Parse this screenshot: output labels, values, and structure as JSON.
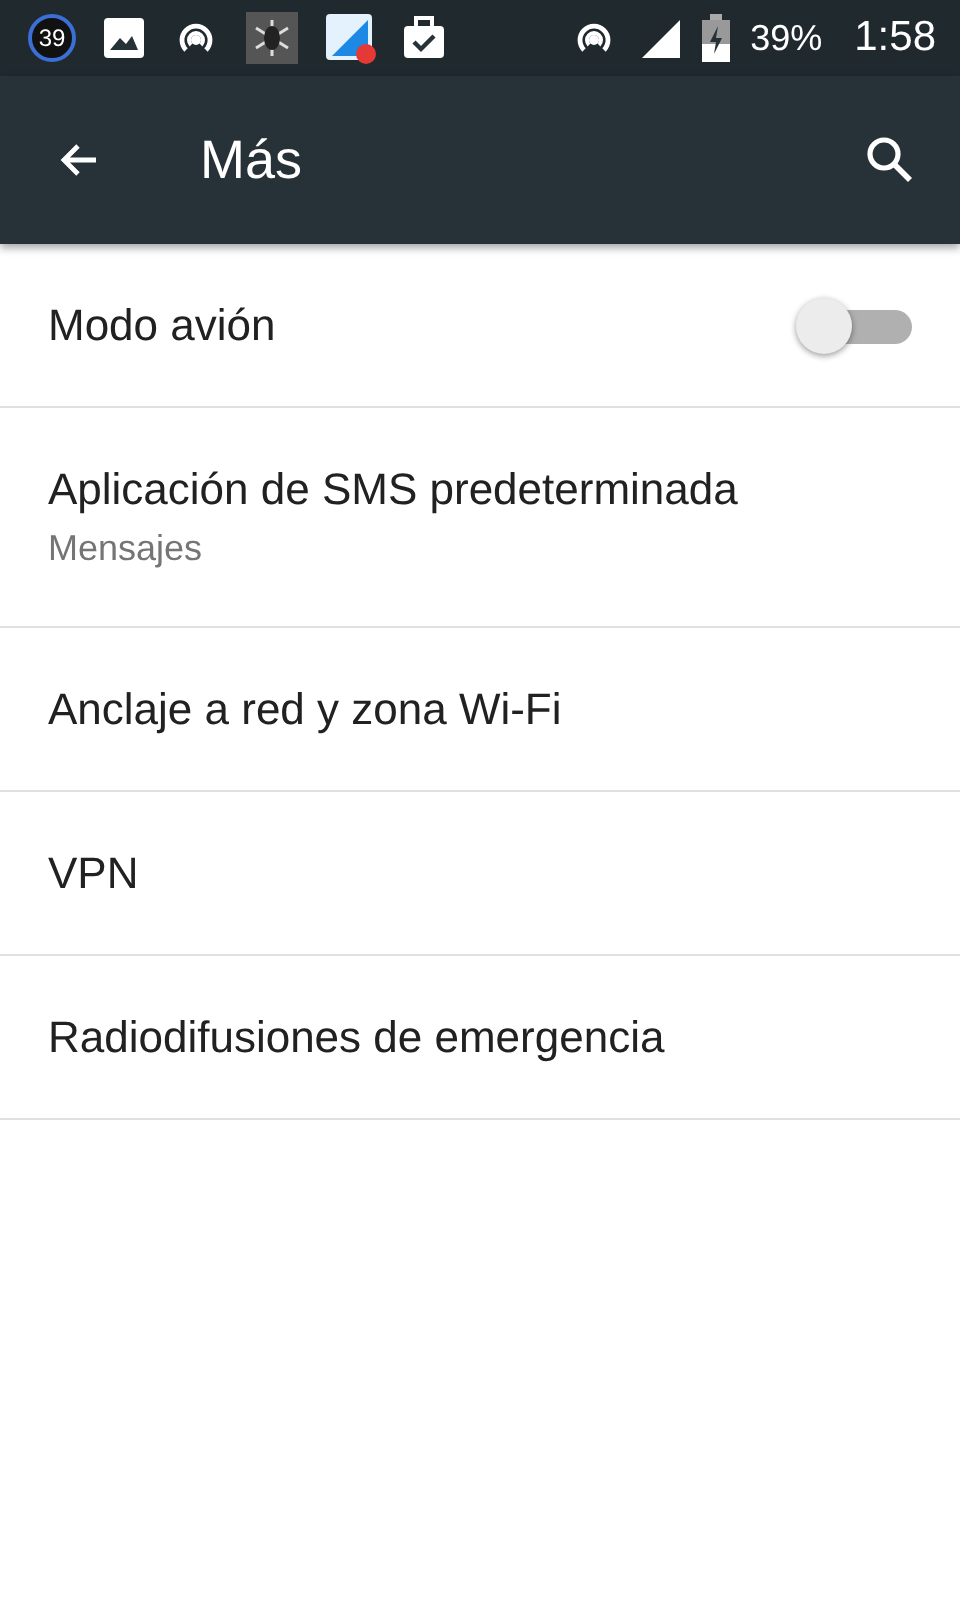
{
  "status_bar": {
    "badge": "39",
    "battery": "39%",
    "time": "1:58"
  },
  "toolbar": {
    "title": "Más"
  },
  "items": [
    {
      "kind": "toggle",
      "title": "Modo avión",
      "on": false
    },
    {
      "kind": "two-line",
      "title": "Aplicación de SMS predeterminada",
      "summary": "Mensajes"
    },
    {
      "kind": "plain",
      "title": "Anclaje a red y zona Wi-Fi"
    },
    {
      "kind": "plain",
      "title": "VPN"
    },
    {
      "kind": "plain",
      "title": "Radiodifusiones de emergencia"
    }
  ]
}
